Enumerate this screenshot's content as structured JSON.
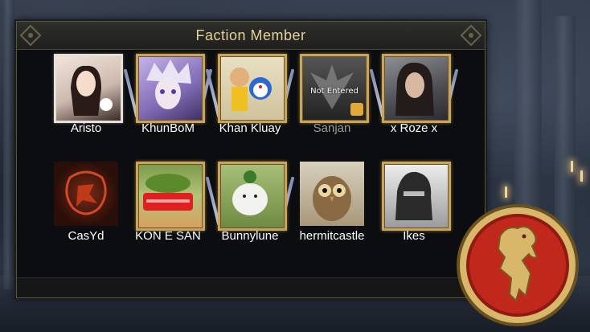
{
  "panel": {
    "title": "Faction Member"
  },
  "members": [
    {
      "name": "Aristo",
      "frame": "white",
      "entered": true
    },
    {
      "name": "KhunBoM",
      "frame": "gold",
      "entered": true
    },
    {
      "name": "Khan Kluay",
      "frame": "gold",
      "entered": true
    },
    {
      "name": "Sanjan",
      "frame": "gold",
      "entered": false,
      "status": "Not Entered"
    },
    {
      "name": "x Roze x",
      "frame": "gold",
      "entered": true
    },
    {
      "name": "CasYd",
      "frame": "none",
      "entered": true
    },
    {
      "name": "KON E SAN",
      "frame": "gold",
      "entered": true
    },
    {
      "name": "Bunnylune",
      "frame": "gold",
      "entered": true
    },
    {
      "name": "hermitcastle",
      "frame": "none",
      "entered": true
    },
    {
      "name": "Ikes",
      "frame": "gold",
      "entered": true
    }
  ],
  "emblem": {
    "icon": "lion-crest-icon",
    "color": "#c0281c",
    "rim": "#d9b76a"
  }
}
